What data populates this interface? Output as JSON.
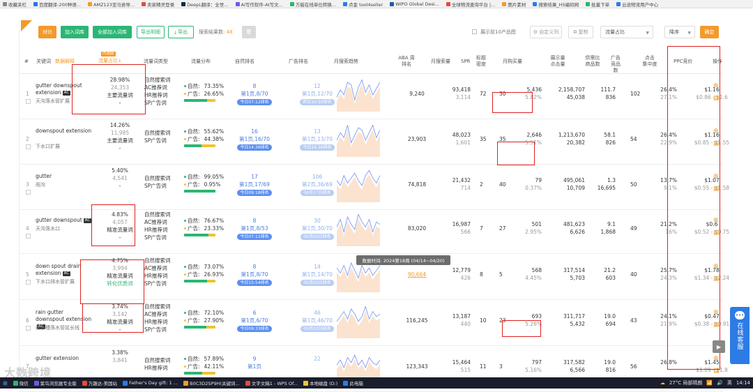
{
  "bookmarks": [
    {
      "label": "收藏夹栏",
      "color": "#888888"
    },
    {
      "label": "百度翻译-200种语...",
      "color": "#2f6ef0"
    },
    {
      "label": "AMZ123亚马逊导...",
      "color": "#f39a2b"
    },
    {
      "label": "卖家精灵登录",
      "color": "#e84a3c"
    },
    {
      "label": "DeepL翻译：全世...",
      "color": "#0f2b46"
    },
    {
      "label": "AI写作软件-AI写文...",
      "color": "#6b5ce7"
    },
    {
      "label": "万能在线单位转换...",
      "color": "#2bb673"
    },
    {
      "label": "点金 tool4seller",
      "color": "#2d7be5"
    },
    {
      "label": "WIPO Global Desi...",
      "color": "#1b5fa8"
    },
    {
      "label": "全球物流查询平台 |...",
      "color": "#e84a3c"
    },
    {
      "label": "图片素材",
      "color": "#f39a2b"
    },
    {
      "label": "搜索结果_HS编码网",
      "color": "#2d7be5"
    },
    {
      "label": "批量下单",
      "color": "#2bb673"
    },
    {
      "label": "云途物流用户中心",
      "color": "#2d7be5"
    }
  ],
  "toolbar": {
    "compare": "对比",
    "add_to_library": "加入词库",
    "add_all_to_library": "全部加入词库",
    "export_details": "导出明细",
    "export": "导出",
    "result_count_label": "搜索结果数:",
    "result_count": "48",
    "show_top10_label": "展示前10产品图",
    "custom_columns": "自定义列",
    "shortcut": "复制",
    "sort_field": "流量占比",
    "sort_order": "降序",
    "confirm": "确定"
  },
  "headers": {
    "index": "#",
    "keyword": "关键词",
    "data_explain": "数据解释",
    "flow_ratio_badge": "内测版",
    "flow_ratio": "流量占比↓",
    "flow_type": "流量词类型",
    "flow_dist": "流量分布",
    "natural_rank": "自然排名",
    "ad_rank": "广告排名",
    "monthly_trend": "月搜索趋势",
    "aba": "ABA 周排名",
    "monthly_search": "月搜索量",
    "spr": "SPR",
    "title_density": "标题 密度",
    "monthly_purchase": "月购买量",
    "display_click": "展示量 点击量",
    "supply_demand": "供需比 商品数",
    "ad_products": "广告 竞品数",
    "click_concentration": "点击 集中度",
    "ppc": "PPC竞价",
    "actions": "操作"
  },
  "rows": [
    {
      "idx": "1",
      "kw": "gutter downspout extension",
      "ac": true,
      "cn": "天沟落水管扩展",
      "ratio": "28.98%",
      "ratio_sub": "24,353",
      "ratio_type": "主要流量词",
      "ratio_extra": "-",
      "types": [
        "自然搜索词",
        "AC推荐词",
        "HR推荐词",
        "SP广告词"
      ],
      "nat_pct": "73.35%",
      "ad_pct": "26.65%",
      "nat_share": 0.73,
      "nat_rank": "8",
      "nat_page": "第1页,8/70",
      "nat_tag": "今日07:12排名",
      "ad_rank": "12",
      "ad_page": "第1页,12/70",
      "ad_tag": "昨日10:50排名",
      "trend": [
        8,
        14,
        10,
        20,
        18,
        6,
        16,
        22,
        12,
        18,
        10,
        15,
        20
      ],
      "aba": "9,240",
      "search": "93,418",
      "search_sub": "3,114",
      "spr": "72",
      "density": "30",
      "purchase": "5,436",
      "purchase_rate": "5.82%",
      "display": "2,158,707",
      "click": "45,038",
      "sd_ratio": "111.7",
      "products": "836",
      "ad_products": "102",
      "conc": "26.4%",
      "conc_sub": "27.1%",
      "ppc": "$1.16",
      "ppc_range": "$0.86 - $1.6"
    },
    {
      "idx": "2",
      "kw": "downspout extension",
      "ac": false,
      "cn": "下水口扩展",
      "ratio": "14.26%",
      "ratio_sub": "11,985",
      "ratio_type": "主要流量词",
      "ratio_extra": "-",
      "types": [
        "自然搜索词",
        "SP广告词"
      ],
      "nat_pct": "55.62%",
      "ad_pct": "44.38%",
      "nat_share": 0.56,
      "nat_rank": "16",
      "nat_page": "第1页,16/70",
      "nat_tag": "今日14:36排名",
      "ad_rank": "13",
      "ad_page": "第1页,13/70",
      "ad_tag": "今日14:36排名",
      "trend": [
        10,
        16,
        12,
        22,
        8,
        14,
        20,
        18,
        10,
        16,
        22,
        12,
        18
      ],
      "aba": "23,903",
      "search": "48,023",
      "search_sub": "1,601",
      "spr": "35",
      "density": "35",
      "purchase": "2,646",
      "purchase_rate": "5.51%",
      "display": "1,213,670",
      "click": "20,382",
      "sd_ratio": "58.1",
      "products": "826",
      "ad_products": "54",
      "conc": "26.4%",
      "conc_sub": "22.9%",
      "ppc": "$1.16",
      "ppc_range": "$0.85 - $1.55"
    },
    {
      "idx": "3",
      "kw": "gutter",
      "ac": false,
      "cn": "雨沟",
      "ratio": "5.40%",
      "ratio_sub": "4,541",
      "ratio_type": "",
      "ratio_extra": "-",
      "types": [
        "自然搜索词",
        "SP广告词"
      ],
      "nat_pct": "99.05%",
      "ad_pct": "0.95%",
      "nat_share": 0.99,
      "nat_rank": "17",
      "nat_page": "第1页,17/69",
      "nat_tag": "今日09:18排名",
      "ad_rank": "106",
      "ad_page": "第2页,36/69",
      "ad_tag": "04月27日排名",
      "trend": [
        14,
        10,
        18,
        12,
        16,
        20,
        14,
        10,
        18,
        22,
        16,
        12,
        18
      ],
      "aba": "74,818",
      "search": "21,432",
      "search_sub": "714",
      "spr": "2",
      "density": "40",
      "purchase": "79",
      "purchase_rate": "0.37%",
      "display": "495,061",
      "click": "10,709",
      "sd_ratio": "1.3",
      "products": "16,695",
      "ad_products": "50",
      "conc": "13.7%",
      "conc_sub": "9.1%",
      "ppc": "$1.07",
      "ppc_range": "$0.55 - $1.58"
    },
    {
      "idx": "4",
      "kw": "gutter downspout",
      "ac": true,
      "cn": "天沟落水口",
      "ratio": "4.83%",
      "ratio_sub": "4,057",
      "ratio_type": "精准流量词",
      "ratio_extra": "-",
      "types": [
        "自然搜索词",
        "AC推荐词",
        "HR推荐词",
        "SP广告词"
      ],
      "nat_pct": "76.67%",
      "ad_pct": "23.33%",
      "nat_share": 0.77,
      "nat_rank": "8",
      "nat_page": "第1页,8/53",
      "nat_tag": "今日07:11排名",
      "ad_rank": "30",
      "ad_page": "第1页,30/70",
      "ad_tag": "05月02日排名",
      "trend": [
        12,
        18,
        8,
        20,
        14,
        10,
        22,
        16,
        12,
        18,
        8,
        16,
        14
      ],
      "aba": "83,020",
      "search": "16,987",
      "search_sub": "566",
      "spr": "7",
      "density": "27",
      "purchase": "501",
      "purchase_rate": "2.95%",
      "display": "481,623",
      "click": "6,626",
      "sd_ratio": "9.1",
      "products": "1,868",
      "ad_products": "49",
      "conc": "21.2%",
      "conc_sub": "16%",
      "ppc": "$0.6",
      "ppc_range": "$0.52 - $0.75"
    },
    {
      "idx": "5",
      "kw": "down spout drain extension",
      "ac": true,
      "cn": "下水口排水管扩展",
      "ratio": "4.75%",
      "ratio_sub": "3,994",
      "ratio_type": "精准流量词",
      "ratio_extra": "转化优质词",
      "types": [
        "自然搜索词",
        "AC推荐词",
        "HR推荐词",
        "SP广告词"
      ],
      "nat_pct": "73.07%",
      "ad_pct": "26.93%",
      "nat_share": 0.73,
      "nat_rank": "8",
      "nat_page": "第1页,8/70",
      "nat_tag": "今日15:54排名",
      "ad_rank": "14",
      "ad_page": "第1页,14/70",
      "ad_tag": "05月02日排名",
      "trend": [
        16,
        12,
        18,
        10,
        20,
        14,
        8,
        18,
        12,
        16,
        10,
        14,
        18
      ],
      "aba": "90,664",
      "search": "12,779",
      "search_sub": "426",
      "spr": "8",
      "density": "5",
      "purchase": "568",
      "purchase_rate": "4.45%",
      "display": "317,514",
      "click": "5,703",
      "sd_ratio": "21.2",
      "products": "603",
      "ad_products": "40",
      "conc": "25.7%",
      "conc_sub": "24.3%",
      "ppc": "$1.78",
      "ppc_range": "$1.34 - $2.24"
    },
    {
      "idx": "6",
      "kw": "rain gutter downspout extension",
      "ac": true,
      "cn": "雨水槽落水管延长线",
      "ratio": "3.74%",
      "ratio_sub": "3,142",
      "ratio_type": "精准流量词",
      "ratio_extra": "-",
      "types": [
        "自然搜索词",
        "AC推荐词",
        "HR推荐词",
        "SP广告词"
      ],
      "nat_pct": "72.10%",
      "ad_pct": "27.90%",
      "nat_share": 0.72,
      "nat_rank": "6",
      "nat_page": "第1页,6/70",
      "nat_tag": "今日09:33排名",
      "ad_rank": "46",
      "ad_page": "第1页,46/70",
      "ad_tag": "05月02日排名",
      "trend": [
        10,
        14,
        18,
        12,
        20,
        16,
        10,
        14,
        22,
        12,
        18,
        14,
        16
      ],
      "aba": "116,245",
      "search": "13,187",
      "search_sub": "440",
      "spr": "10",
      "density": "23",
      "purchase": "693",
      "purchase_rate": "5.26%",
      "display": "311,717",
      "click": "5,432",
      "sd_ratio": "19.0",
      "products": "694",
      "ad_products": "43",
      "conc": "24.1%",
      "conc_sub": "21.9%",
      "ppc": "$0.47",
      "ppc_range": "$0.38 - $0.91"
    },
    {
      "idx": "7",
      "kw": "gutter extension",
      "ac": false,
      "cn": "",
      "ratio": "3.38%",
      "ratio_sub": "3,841",
      "ratio_type": "",
      "ratio_extra": "",
      "types": [
        "自然搜索词",
        "HR推荐词"
      ],
      "nat_pct": "57.89%",
      "ad_pct": "42.11%",
      "nat_share": 0.58,
      "nat_rank": "9",
      "nat_page": "第1页",
      "nat_tag": "",
      "ad_rank": "22",
      "ad_page": "",
      "ad_tag": "",
      "trend": [
        12,
        16,
        10,
        18,
        14,
        20,
        12,
        16,
        10,
        18,
        14,
        12,
        16
      ],
      "aba": "123,343",
      "search": "15,464",
      "search_sub": "515",
      "spr": "11",
      "density": "3",
      "purchase": "797",
      "purchase_rate": "5.16%",
      "display": "317,582",
      "click": "6,566",
      "sd_ratio": "19.0",
      "products": "816",
      "ad_products": "56",
      "conc": "26.8%",
      "conc_sub": "",
      "ppc": "$1.45",
      "ppc_range": "$1.09 - $1.8"
    }
  ],
  "tooltip": "数据时间: 2024第18周 (04/14~04/20)",
  "sidebar": {
    "label": "在线客服"
  },
  "watermark": "大数跨境",
  "taskbar": {
    "items": [
      {
        "label": "微信",
        "color": "#2bb673"
      },
      {
        "label": "紫鸟浏览器专业版",
        "color": "#6b5ce7"
      },
      {
        "label": "万趣达-美国站",
        "color": "#e84a3c"
      },
      {
        "label": "Father's Day gift: 1 ...",
        "color": "#2d7be5"
      },
      {
        "label": "B0C3D2SP9H(关键词...",
        "color": "#f39a2b"
      },
      {
        "label": "文字文稿1 - WPS Of...",
        "color": "#e84a3c"
      },
      {
        "label": "本地磁盘 (D:)",
        "color": "#f0c234"
      },
      {
        "label": "此电脑",
        "color": "#2d7be5"
      }
    ],
    "weather": "27°C 局部晴朗",
    "lang": "英",
    "time": "14:14"
  }
}
